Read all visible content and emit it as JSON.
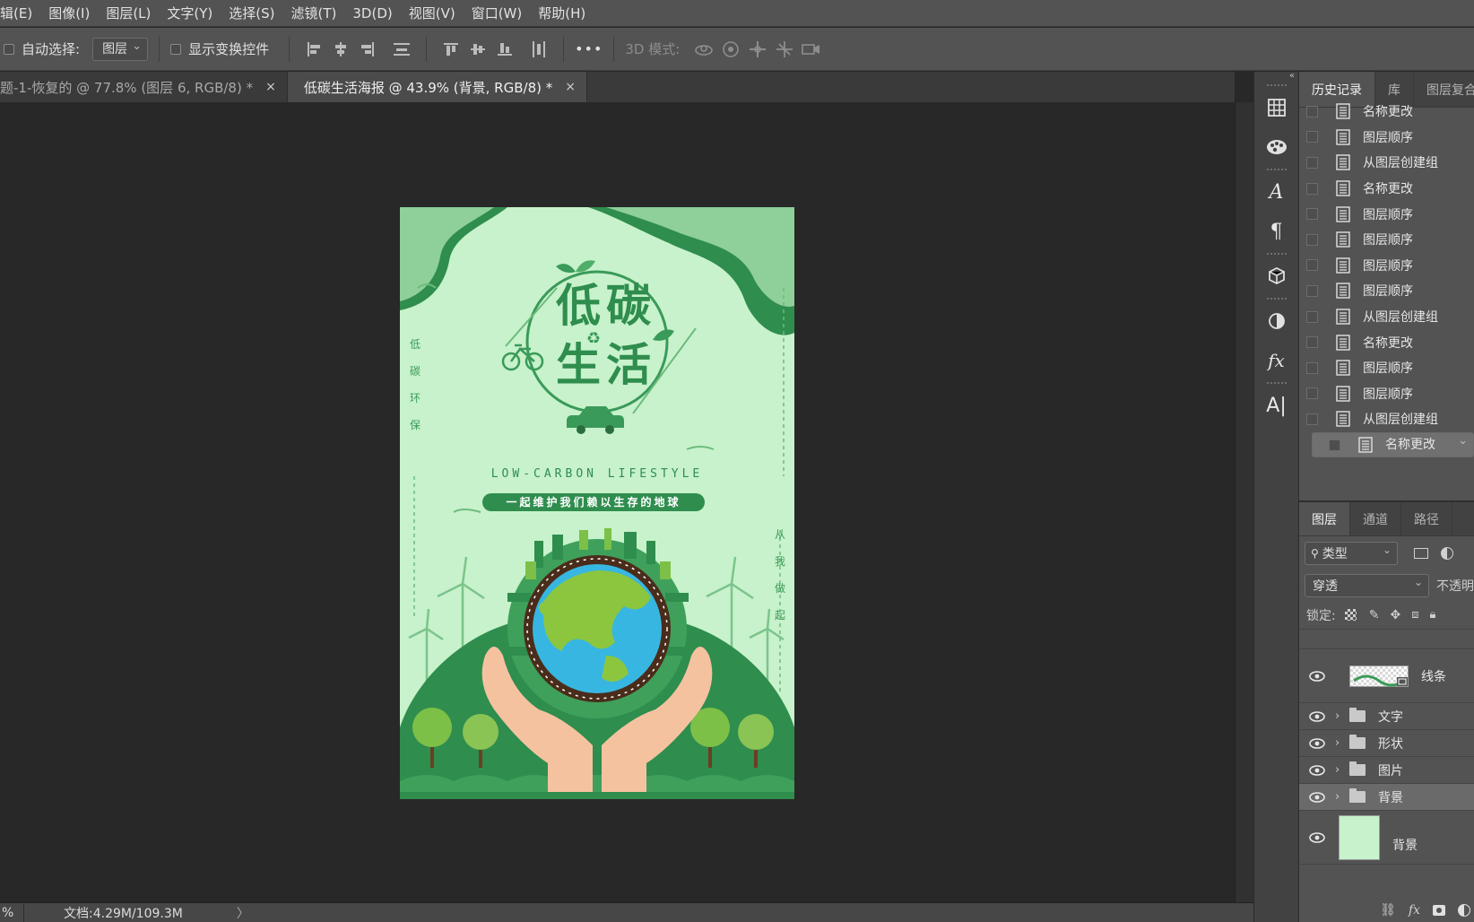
{
  "menu": [
    "辑(E)",
    "图像(I)",
    "图层(L)",
    "文字(Y)",
    "选择(S)",
    "滤镜(T)",
    "3D(D)",
    "视图(V)",
    "窗口(W)",
    "帮助(H)"
  ],
  "options": {
    "auto_select_label": "自动选择:",
    "auto_select_value": "图层",
    "show_transform_label": "显示变换控件",
    "more": "•••",
    "mode3d_label": "3D 模式:"
  },
  "tabs": [
    {
      "label": "题-1-恢复的 @ 77.8% (图层 6, RGB/8) *",
      "close": "×"
    },
    {
      "label": "低碳生活海报 @ 43.9% (背景, RGB/8) *",
      "close": "×"
    }
  ],
  "poster": {
    "title_line1": "低碳",
    "title_line2": "生活",
    "subtitle_en": "LOW-CARBON LIFESTYLE",
    "slogan": "一起维护我们赖以生存的地球",
    "left_vertical": [
      "低",
      "碳",
      "环",
      "保"
    ],
    "right_vertical": [
      "从",
      "我",
      "做",
      "起"
    ]
  },
  "status": {
    "zoom": "%",
    "doc_info": "文档:4.29M/109.3M",
    "arrow": "〉"
  },
  "history_panel": {
    "tabs": [
      "历史记录",
      "库",
      "图层复合"
    ],
    "items": [
      "名称更改",
      "图层顺序",
      "从图层创建组",
      "名称更改",
      "图层顺序",
      "图层顺序",
      "图层顺序",
      "图层顺序",
      "从图层创建组",
      "名称更改",
      "图层顺序",
      "图层顺序",
      "从图层创建组",
      "名称更改"
    ],
    "selected_index": 13
  },
  "layers_panel": {
    "tabs": [
      "图层",
      "通道",
      "路径"
    ],
    "filter_label": "类型",
    "blend_mode": "穿透",
    "opacity_label": "不透明",
    "lock_label": "锁定:",
    "layers": [
      {
        "name": "线条",
        "type": "smart"
      },
      {
        "name": "文字",
        "type": "group"
      },
      {
        "name": "形状",
        "type": "group"
      },
      {
        "name": "图片",
        "type": "group"
      },
      {
        "name": "背景",
        "type": "group",
        "selected": true
      },
      {
        "name": "背景",
        "type": "fill",
        "color": "#c7f2cb"
      }
    ],
    "footer": [
      "link-icon",
      "fx-icon",
      "mask-icon",
      "adjustment-icon"
    ],
    "fx_label": "fx"
  },
  "toolstrip_icons": [
    "grid-icon",
    "palette-icon",
    "character-icon",
    "paragraph-icon",
    "3d-cube-icon",
    "adjustments-icon",
    "fx-icon",
    "type-cursor-icon"
  ],
  "colors": {
    "poster_bg": "#c7f2cb",
    "poster_dark_green": "#2f8d4e",
    "panel_bg": "#535353"
  }
}
